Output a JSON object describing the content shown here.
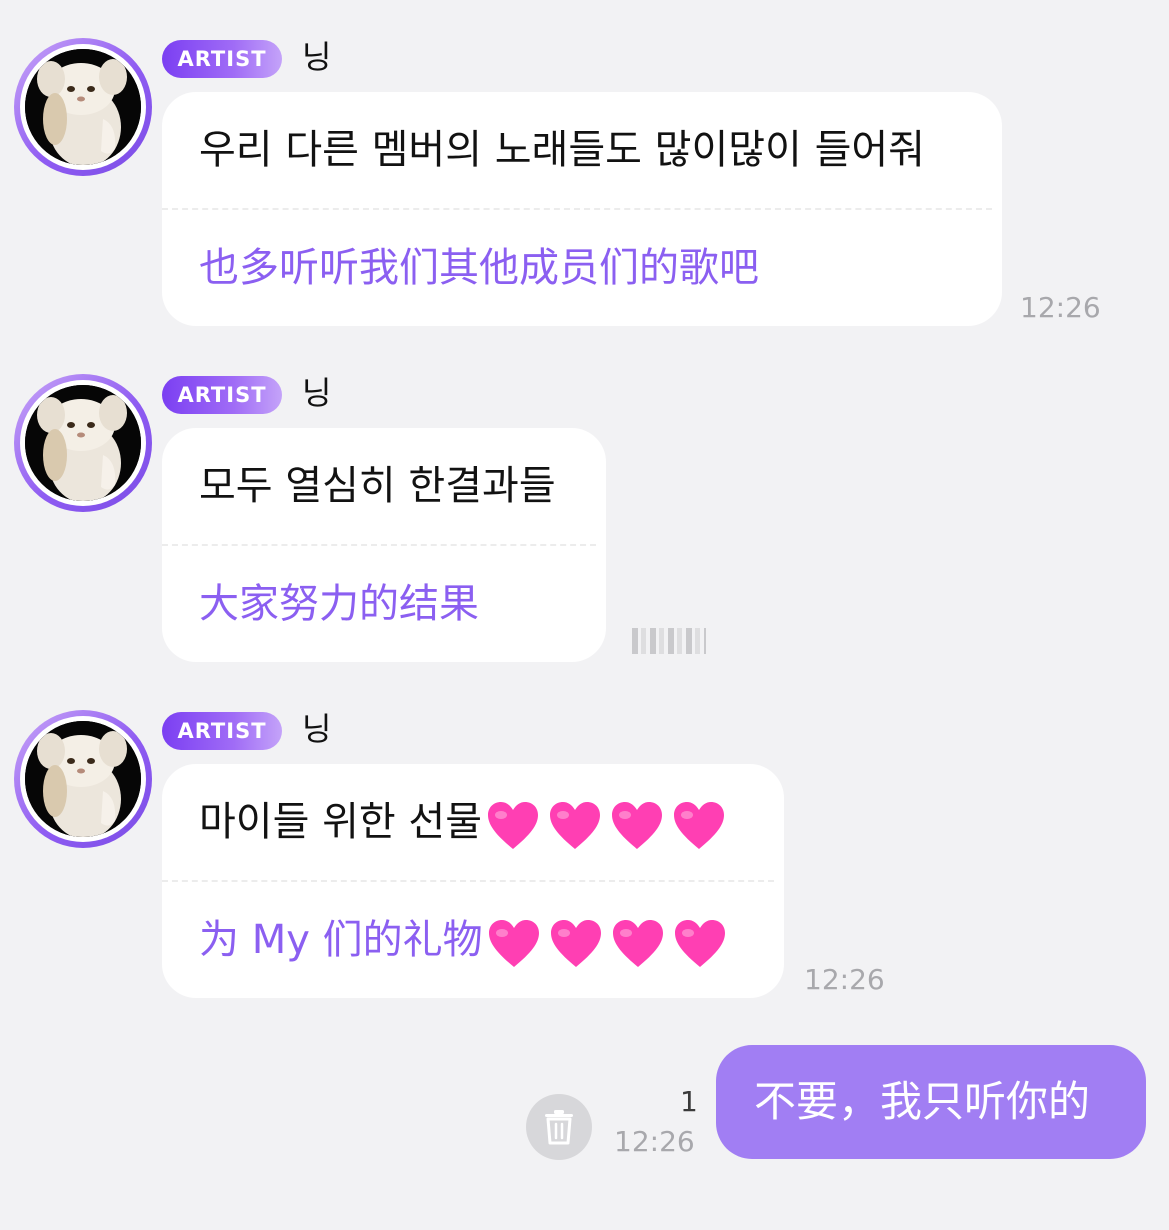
{
  "messages": [
    {
      "badge": "ARTIST",
      "sender": "닝",
      "text_ko": "우리 다른 멤버의 노래들도 많이많이 들어줘",
      "text_zh": "也多听听我们其他成员们的歌吧",
      "time": "12:26"
    },
    {
      "badge": "ARTIST",
      "sender": "닝",
      "text_ko": "모두 열심히 한결과들",
      "text_zh": "大家努力的结果",
      "time": ""
    },
    {
      "badge": "ARTIST",
      "sender": "닝",
      "text_ko": "마이들 위한 선물",
      "text_zh": "为 My 们的礼物",
      "time": "12:26",
      "heart_count": 4
    }
  ],
  "my_message": {
    "text": "不要，我只听你的",
    "time": "12:26",
    "unread_count": "1"
  },
  "colors": {
    "accent": "#8b5ff1",
    "my_bubble": "#a17ef3",
    "heart": "#ff3fb3",
    "background": "#f2f2f4"
  },
  "icons": {
    "avatar": "fluffy-cat-avatar",
    "delete": "trash-icon",
    "heart": "pink-heart-emoji"
  }
}
